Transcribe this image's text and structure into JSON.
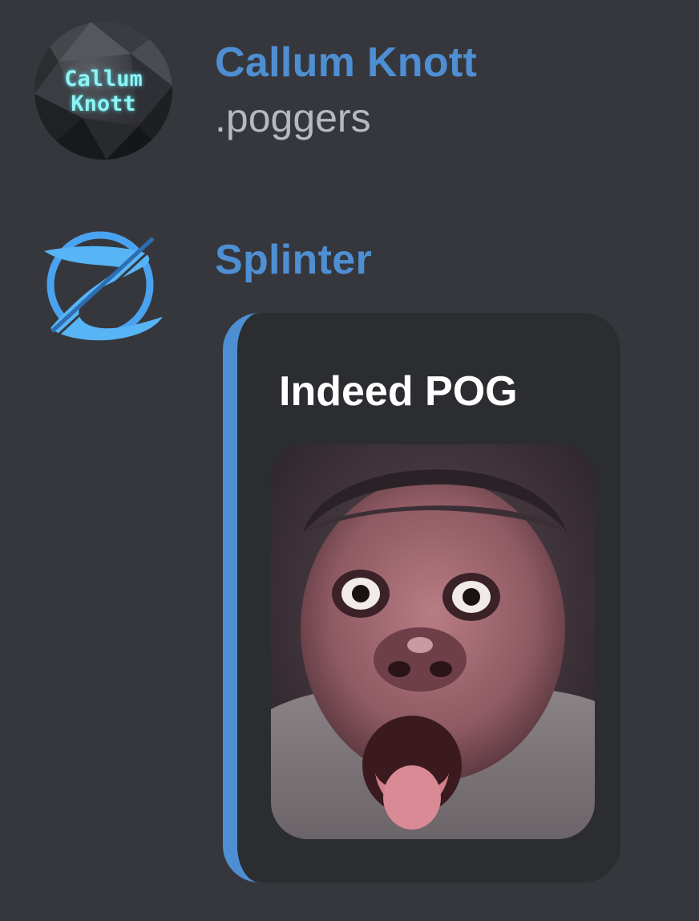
{
  "messages": [
    {
      "author": "Callum Knott",
      "avatar_text_line1": "Callum",
      "avatar_text_line2": "Knott",
      "avatar_icon": "callum-knott-avatar",
      "text": ".poggers"
    },
    {
      "author": "Splinter",
      "avatar_icon": "splinter-logo-icon",
      "embed": {
        "title": "Indeed POG",
        "image": "surprised-face-gif",
        "accent_color": "#4e8fd3"
      }
    }
  ],
  "colors": {
    "background": "#36373d",
    "username": "#4e8fd3",
    "message_text": "#b6b9c0",
    "embed_background": "#2b2d31",
    "embed_title": "#ffffff"
  }
}
